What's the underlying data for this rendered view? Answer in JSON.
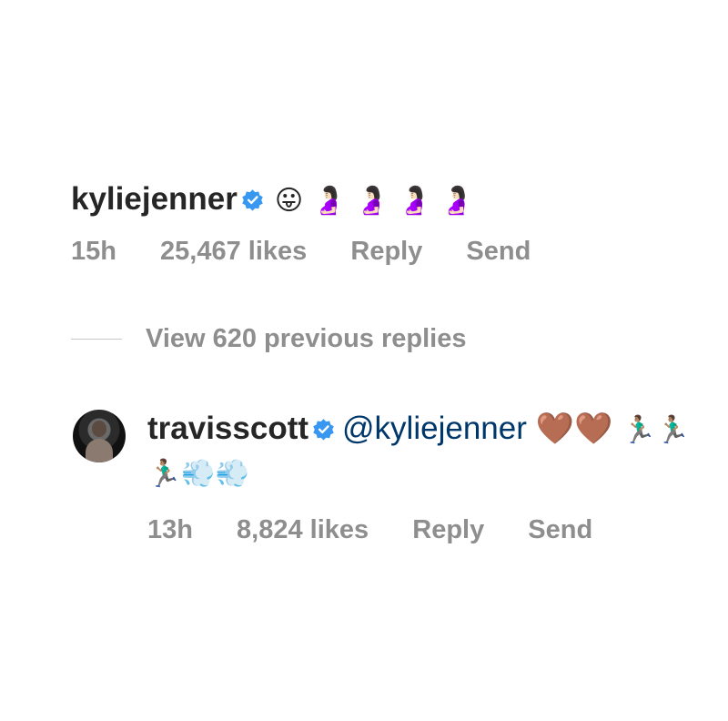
{
  "comment": {
    "username": "kyliejenner",
    "emojis": "😛 🤰🏻 🤰🏻 🤰🏻 🤰🏻",
    "time": "15h",
    "likes": "25,467 likes",
    "reply_label": "Reply",
    "send_label": "Send"
  },
  "view_replies": {
    "label": "View 620 previous replies"
  },
  "reply": {
    "username": "travisscott",
    "mention": "@kyliejenner",
    "hearts": "🤎🤎",
    "emojis": "🏃🏽‍♂️🏃🏽‍♂️🏃🏽‍♂️💨💨",
    "time": "13h",
    "likes": "8,824 likes",
    "reply_label": "Reply",
    "send_label": "Send"
  },
  "colors": {
    "text": "#262626",
    "secondary": "#8e8e8e",
    "mention": "#00376b",
    "verified": "#3897f0",
    "heart": "#7b4a22"
  }
}
